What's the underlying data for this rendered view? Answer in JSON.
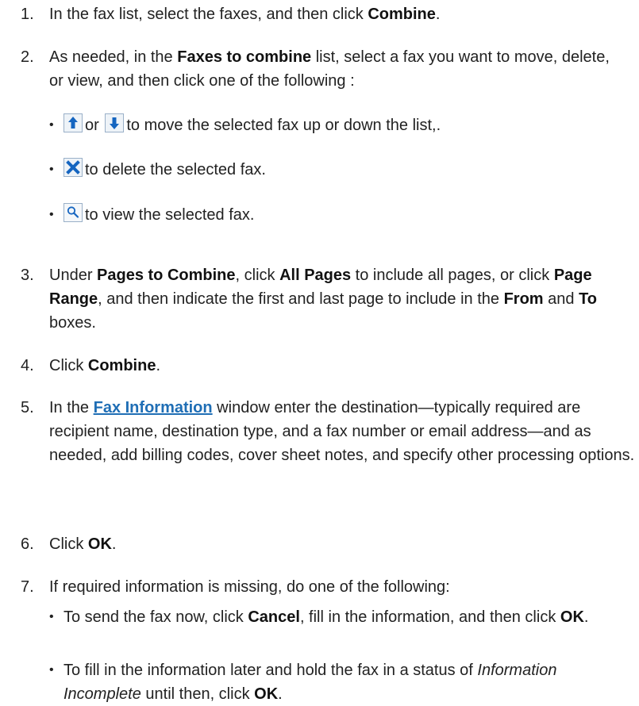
{
  "steps": [
    {
      "n": "1.",
      "pre": "In the fax list, select the faxes, and then click ",
      "b1": "Combine",
      "post": "."
    },
    {
      "n": "2.",
      "pre": "As needed, in the ",
      "b1": "Faxes to combine",
      "post": " list, select a fax you want to move, delete, or view, and then click one of the following :"
    },
    {
      "n": "3.",
      "pre": "Under ",
      "b1": "Pages to Combine",
      "mid1": ", click ",
      "b2": "All Pages",
      "mid2": " to include all pages, or click ",
      "b3": "Page Range",
      "mid3": ", and then indicate the first and last page to include in the ",
      "b4": "From",
      "mid4": " and ",
      "b5": "To",
      "post": " boxes."
    },
    {
      "n": "4.",
      "pre": "Click ",
      "b1": "Combine",
      "post": "."
    },
    {
      "n": "5.",
      "pre": "In the ",
      "link": "Fax Information",
      "post": " window enter the destination—typically required are recipient name, destination type, and a fax number or email address—and as needed, add billing codes, cover sheet notes, and specify other processing options."
    },
    {
      "n": "6.",
      "pre": "Click ",
      "b1": "OK",
      "post": "."
    },
    {
      "n": "7.",
      "pre": "If required information is missing, do one of the following:"
    }
  ],
  "icon_bullets": {
    "move": {
      "or": "or",
      "text": "to move the selected fax up or down the list,."
    },
    "delete": {
      "text": "to delete the selected fax."
    },
    "view": {
      "text": "to view the selected fax."
    },
    "icons": [
      "arrow-up-icon",
      "arrow-down-icon",
      "delete-x-icon",
      "magnifier-icon"
    ]
  },
  "sub_bullets": [
    {
      "pre": "To send the fax now, click ",
      "b1": "Cancel",
      "mid1": ", fill in the information, and then click ",
      "b2": "OK",
      "post": "."
    },
    {
      "pre": "To fill in the information later and hold the fax in a status of ",
      "i1": "Information Incomplete",
      "mid1": " until then, click ",
      "b2": "OK",
      "post": "."
    }
  ],
  "bullet_glyph": "•",
  "colors": {
    "text": "#222222",
    "link": "#1f6eb5",
    "icon_blue": "#1565c0",
    "icon_border": "#9ab0c8"
  }
}
